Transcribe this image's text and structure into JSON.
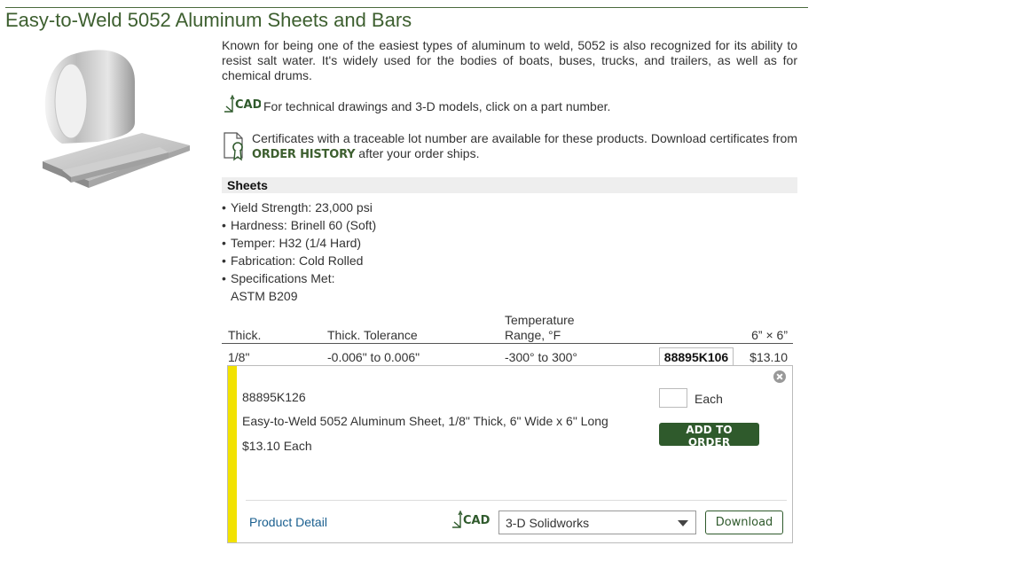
{
  "page": {
    "title": "Easy-to-Weld 5052 Aluminum Sheets and Bars",
    "intro": "Known for being one of the easiest types of aluminum to weld, 5052 is also recognized for its ability to resist salt water. It's widely used for the bodies of boats, buses, trucks, and trailers, as well as for chemical drums.",
    "cad_icon_text": "CAD",
    "cad_note": "For technical drawings and 3-D models, click on a part number.",
    "cert_note_before": "Certificates with a traceable lot number are available for these products. Download certificates from",
    "cert_note_link": "ORDER HISTORY",
    "cert_note_after": "after your order ships."
  },
  "section": {
    "header": "Sheets",
    "specs": [
      "Yield Strength: 23,000 psi",
      "Hardness: Brinell 60 (Soft)",
      "Temper: H32 (1/4 Hard)",
      "Fabrication: Cold Rolled",
      "Specifications Met:"
    ],
    "spec_standard": "ASTM B209"
  },
  "table": {
    "headers": {
      "thick": "Thick.",
      "tolerance": "Thick. Tolerance",
      "temp_line1": "Temperature",
      "temp_line2": "Range, °F",
      "size": "6” × 6”"
    },
    "row": {
      "thick": "1/8\"",
      "tolerance": "-0.006\" to 0.006\"",
      "temp": "-300° to 300°",
      "part_number": "88895K106",
      "price": "$13.10"
    }
  },
  "detail": {
    "part_number": "88895K126",
    "description": "Easy-to-Weld 5052 Aluminum Sheet, 1/8\" Thick, 6\" Wide x 6\" Long",
    "price": "$13.10 Each",
    "qty_unit": "Each",
    "add_button": "ADD TO ORDER",
    "product_detail_link": "Product Detail",
    "cad_format": "3-D Solidworks",
    "download_button": "Download"
  },
  "colors": {
    "title_green": "#3d5f2f",
    "button_green": "#2f5a2c",
    "highlight_bar": "#f2e200",
    "link_blue": "#1a5f8f"
  }
}
